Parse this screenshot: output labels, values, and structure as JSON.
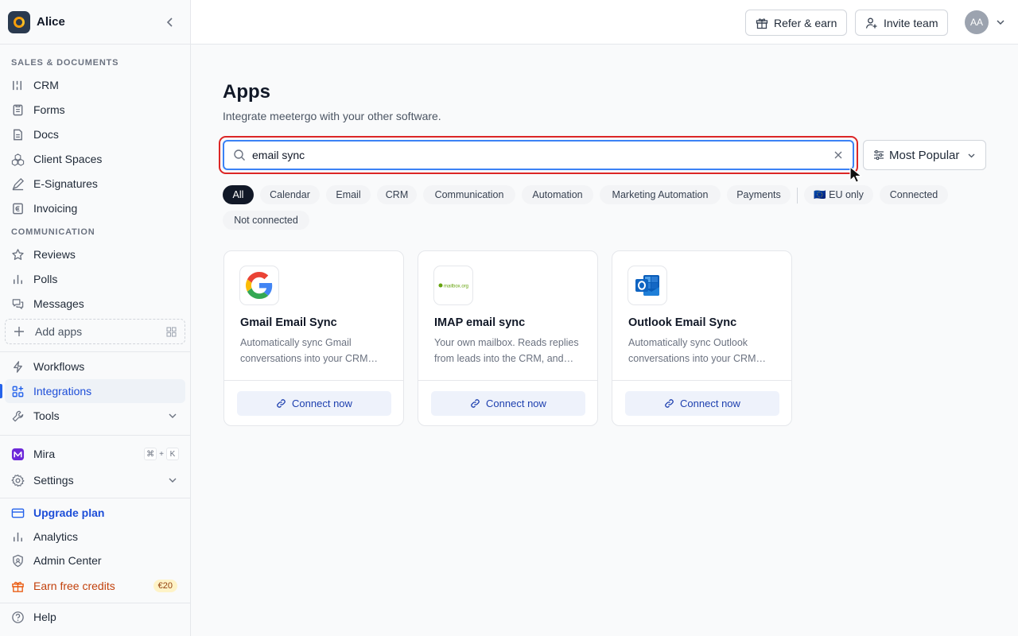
{
  "workspace": {
    "name": "Alice"
  },
  "sidebar": {
    "section_sales": "SALES & DOCUMENTS",
    "sales_items": [
      {
        "label": "CRM",
        "icon": "crm-icon"
      },
      {
        "label": "Forms",
        "icon": "forms-icon"
      },
      {
        "label": "Docs",
        "icon": "docs-icon"
      },
      {
        "label": "Client Spaces",
        "icon": "client-spaces-icon"
      },
      {
        "label": "E-Signatures",
        "icon": "signature-icon"
      },
      {
        "label": "Invoicing",
        "icon": "invoice-icon"
      }
    ],
    "section_comm": "COMMUNICATION",
    "comm_items": [
      {
        "label": "Reviews",
        "icon": "star-icon"
      },
      {
        "label": "Polls",
        "icon": "bar-chart-icon"
      },
      {
        "label": "Messages",
        "icon": "messages-icon"
      }
    ],
    "add_apps": "Add apps",
    "workflows": "Workflows",
    "integrations": "Integrations",
    "tools": "Tools",
    "mira": "Mira",
    "mira_shortcut": {
      "cmd": "⌘",
      "plus": "+",
      "key": "K"
    },
    "settings": "Settings",
    "upgrade": "Upgrade plan",
    "analytics": "Analytics",
    "admin": "Admin Center",
    "earn": "Earn free credits",
    "earn_badge": "€20",
    "help": "Help"
  },
  "header": {
    "refer": "Refer & earn",
    "invite": "Invite team",
    "avatar_initials": "AA"
  },
  "main": {
    "title": "Apps",
    "subtitle": "Integrate meetergo with your other software.",
    "search_value": "email sync",
    "sort_label": "Most Popular",
    "filters": [
      "All",
      "Calendar",
      "Email",
      "CRM",
      "Communication",
      "Automation",
      "Marketing Automation",
      "Payments",
      "🇪🇺 EU only",
      "Connected",
      "Not connected"
    ],
    "active_filter": "All",
    "cards": [
      {
        "title": "Gmail Email Sync",
        "desc": "Automatically sync Gmail conversations into your CRM…",
        "button": "Connect now",
        "logo": "google-logo"
      },
      {
        "title": "IMAP email sync",
        "desc": "Your own mailbox. Reads replies from leads into the CRM, and…",
        "button": "Connect now",
        "logo": "mailbox-org-logo",
        "logo_text": "mailbox.org"
      },
      {
        "title": "Outlook Email Sync",
        "desc": "Automatically sync Outlook conversations into your CRM…",
        "button": "Connect now",
        "logo": "outlook-logo"
      }
    ]
  },
  "colors": {
    "accent": "#2563eb",
    "highlight": "#dc2626",
    "chip_active": "#111827"
  }
}
